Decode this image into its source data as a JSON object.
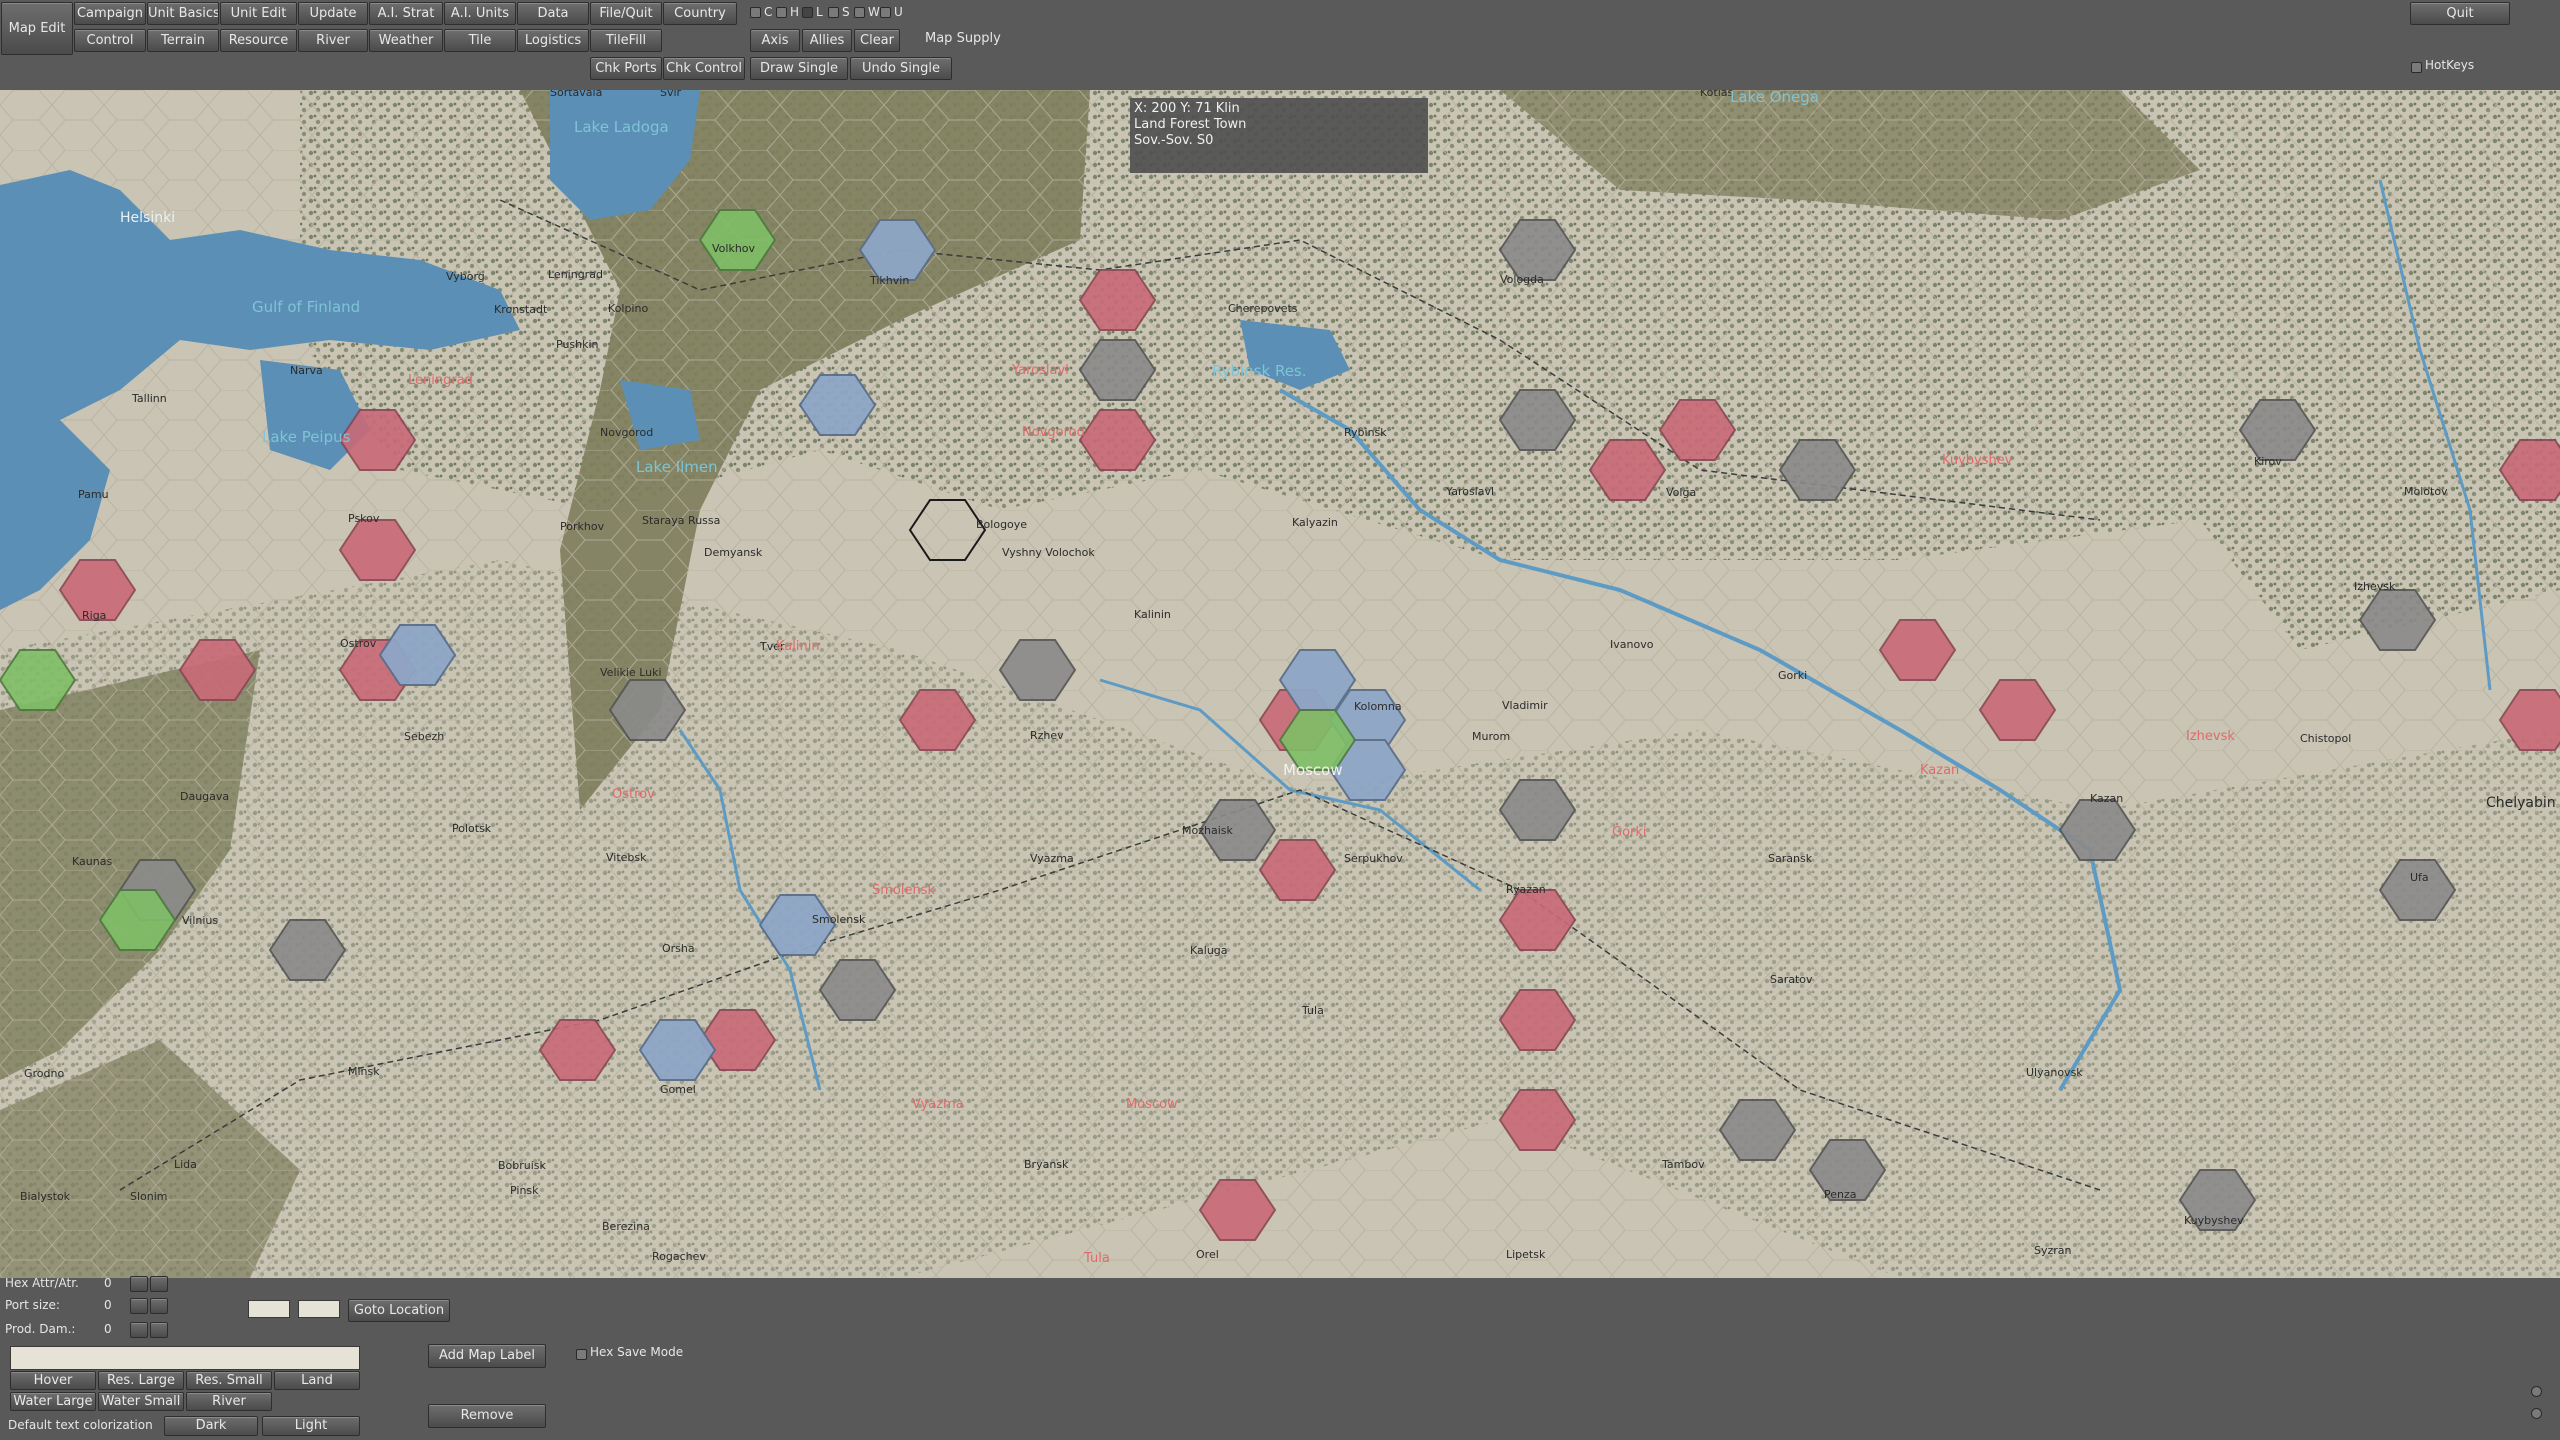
{
  "toolbar": {
    "map_edit": "Map Edit",
    "row1": [
      "Campaign",
      "Unit Basics",
      "Unit Edit",
      "Update",
      "A.I. Strat",
      "A.I. Units",
      "Data",
      "File/Quit",
      "Country"
    ],
    "row2": [
      "Control",
      "Terrain",
      "Resource",
      "River",
      "Weather",
      "Tile",
      "Logistics",
      "TileFill"
    ],
    "row3": [
      "Chk Ports",
      "Chk Control"
    ],
    "filters": [
      "C",
      "H",
      "L",
      "S",
      "W",
      "U"
    ],
    "axis": "Axis",
    "allies": "Allies",
    "clear": "Clear",
    "draw_single": "Draw Single",
    "undo_single": "Undo Single",
    "map_supply": "Map Supply",
    "quit": "Quit",
    "hotkeys": "HotKeys"
  },
  "info": {
    "coords": "X: 200 Y: 71 Klin",
    "terrain": "Land Forest Town",
    "owner": "Sov.-Sov.  S0"
  },
  "map": {
    "cities": [
      {
        "name": "Helsinki"
      },
      {
        "name": "Vyborg"
      },
      {
        "name": "Leningrad"
      },
      {
        "name": "Kronstadt"
      },
      {
        "name": "Kolpino"
      },
      {
        "name": "Pushkin"
      },
      {
        "name": "Tikhvin"
      },
      {
        "name": "Volkhov"
      },
      {
        "name": "Tallinn"
      },
      {
        "name": "Narva"
      },
      {
        "name": "Novgorod"
      },
      {
        "name": "Pskov"
      },
      {
        "name": "Riga"
      },
      {
        "name": "Ostrov"
      },
      {
        "name": "Velikie Luki"
      },
      {
        "name": "Kalinin"
      },
      {
        "name": "Rzhev"
      },
      {
        "name": "Vyazma"
      },
      {
        "name": "Smolensk"
      },
      {
        "name": "Moscow"
      },
      {
        "name": "Kaluga"
      },
      {
        "name": "Tula"
      },
      {
        "name": "Ryazan"
      },
      {
        "name": "Vladimir"
      },
      {
        "name": "Ivanovo"
      },
      {
        "name": "Gorki"
      },
      {
        "name": "Kazan"
      },
      {
        "name": "Yaroslavl"
      },
      {
        "name": "Rybinsk"
      },
      {
        "name": "Vologda"
      },
      {
        "name": "Kirov"
      },
      {
        "name": "Molotov"
      },
      {
        "name": "Izhevsk"
      },
      {
        "name": "Ufa"
      },
      {
        "name": "Chelyabin"
      },
      {
        "name": "Ulyanovsk"
      },
      {
        "name": "Kuybyshev"
      },
      {
        "name": "Penza"
      },
      {
        "name": "Tambov"
      },
      {
        "name": "Saratov"
      },
      {
        "name": "Orel"
      },
      {
        "name": "Bryansk"
      },
      {
        "name": "Minsk"
      },
      {
        "name": "Vilnius"
      },
      {
        "name": "Kaunas"
      },
      {
        "name": "Daugava"
      },
      {
        "name": "Orsha"
      },
      {
        "name": "Gomel"
      },
      {
        "name": "Bobruisk"
      },
      {
        "name": "Lipetsk"
      },
      {
        "name": "Kalyazin"
      },
      {
        "name": "Volga"
      },
      {
        "name": "Cherepovets"
      },
      {
        "name": "Kotlas"
      },
      {
        "name": "Pamu"
      },
      {
        "name": "Bialystok"
      },
      {
        "name": "Slonim"
      },
      {
        "name": "Grodno"
      },
      {
        "name": "Lida"
      },
      {
        "name": "Pinsk"
      },
      {
        "name": "Berezina"
      },
      {
        "name": "Rogachev"
      },
      {
        "name": "Vitebsk"
      },
      {
        "name": "Polotsk"
      },
      {
        "name": "Sebezh"
      },
      {
        "name": "Porkhov"
      },
      {
        "name": "Staraya Russa"
      },
      {
        "name": "Demyansk"
      },
      {
        "name": "Bologoye"
      },
      {
        "name": "Vyshny Volochok"
      },
      {
        "name": "Tver"
      },
      {
        "name": "Mozhaisk"
      },
      {
        "name": "Serpukhov"
      },
      {
        "name": "Kolomna"
      },
      {
        "name": "Murom"
      },
      {
        "name": "Saransk"
      },
      {
        "name": "Syzran"
      },
      {
        "name": "Chistopol"
      },
      {
        "name": "Lake Ladoga"
      },
      {
        "name": "Lake Onega"
      },
      {
        "name": "Lake Ilmen"
      },
      {
        "name": "Lake Peipus"
      },
      {
        "name": "Gulf of Finland"
      },
      {
        "name": "Rybinsk Res."
      },
      {
        "name": "Sortavala"
      },
      {
        "name": "Svir"
      }
    ],
    "regions": [
      "Kazan",
      "Gorki",
      "Moscow",
      "Tula",
      "Vyazma",
      "Kalinin",
      "Yaroslavl",
      "Novgorod",
      "Leningrad",
      "Ostrov",
      "Izhevsk",
      "Kuybyshev",
      "Smolensk"
    ]
  },
  "bottom": {
    "hex_attr": "Hex Attr/Atr.",
    "hex_attr_val": "0",
    "port_size": "Port size:",
    "port_size_val": "0",
    "prod_dam": "Prod. Dam.:",
    "prod_dam_val": "0",
    "goto_location": "Goto Location",
    "label_buttons_row1": [
      "Hover",
      "Res. Large",
      "Res. Small",
      "Land"
    ],
    "label_buttons_row2": [
      "Water Large",
      "Water Small",
      "River"
    ],
    "default_text": "Default text colorization",
    "dark": "Dark",
    "light": "Light",
    "add_map_label": "Add Map Label",
    "hex_save_mode": "Hex Save Mode",
    "remove": "Remove"
  },
  "colors": {
    "ui_bg": "#595959",
    "map_bg": "#c9c4b4",
    "land_green": "#77795a",
    "water": "#5b8fb5",
    "axis_red": "#c96a78",
    "neutral_grey": "#8a8a8a",
    "allied_blue": "#8ea6c6"
  }
}
